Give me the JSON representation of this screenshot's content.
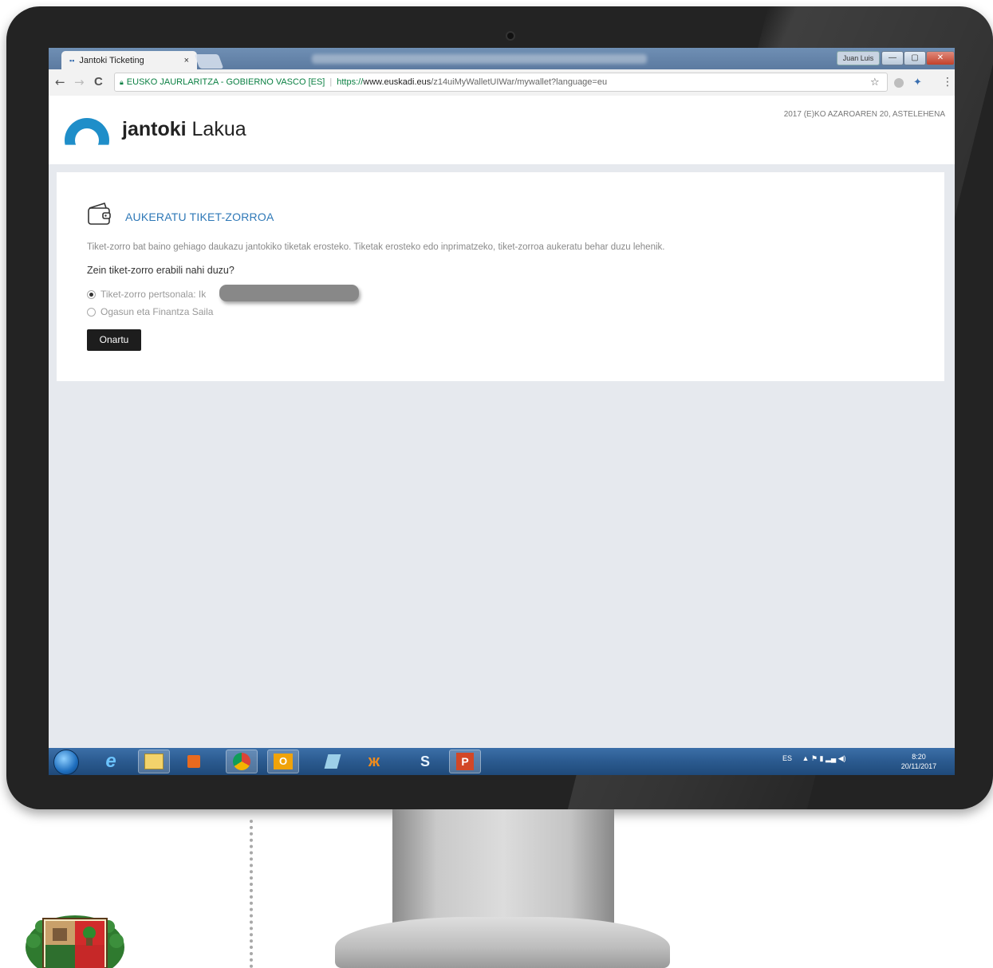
{
  "browser": {
    "tab_title": "Jantoki Ticketing",
    "tab_close": "×",
    "user_chip": "Juan Luis",
    "window_buttons": [
      "—",
      "▢",
      "✕"
    ],
    "nav": {
      "back": "←",
      "forward": "→",
      "reload": "C"
    },
    "address": {
      "secure_label": "EUSKO JAURLARITZA - GOBIERNO VASCO [ES]",
      "url_scheme": "https://",
      "url_host": "www.euskadi.eus",
      "url_path": "/z14uiMyWalletUIWar/mywallet?language=eu"
    },
    "star": "☆",
    "menu": "⋮"
  },
  "header": {
    "brand_bold": "jantoki",
    "brand_rest": " Lakua",
    "date": "2017 (E)KO AZAROAREN 20, ASTELEHENA",
    "brand_color": "#1f8ec9"
  },
  "main": {
    "title": "AUKERATU TIKET-ZORROA",
    "description": "Tiket-zorro bat baino gehiago daukazu jantokiko tiketak erosteko. Tiketak erosteko edo inprimatzeko, tiket-zorroa aukeratu behar duzu lehenik.",
    "question": "Zein tiket-zorro erabili nahi duzu?",
    "options": [
      {
        "label": "Tiket-zorro pertsonala: Ik",
        "selected": true
      },
      {
        "label": "Ogasun eta Finantza Saila",
        "selected": false
      }
    ],
    "submit_label": "Onartu",
    "title_color": "#2e78b7"
  },
  "taskbar": {
    "apps": [
      "start",
      "internet-explorer",
      "file-explorer",
      "media-player",
      "chrome",
      "outlook",
      "notes",
      "butterfly",
      "skype-for-business",
      "powerpoint"
    ],
    "app_glyphs": {
      "ie": "e",
      "outlook": "O",
      "skype": "S",
      "powerpoint": "P"
    },
    "language": "ES",
    "tray_icons": "▲  ⚑  ▮  ▂▄  ◀)",
    "time": "8:20",
    "date": "20/11/2017"
  }
}
